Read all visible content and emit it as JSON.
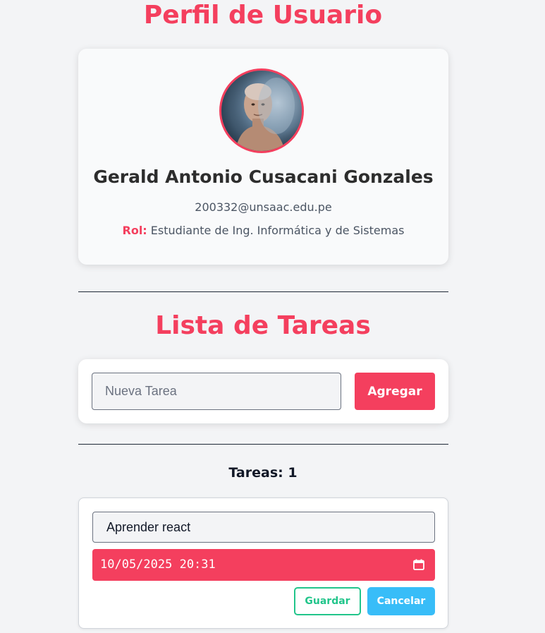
{
  "profile": {
    "title": "Perfil de Usuario",
    "name": "Gerald Antonio Cusacani Gonzales",
    "email": "200332@unsaac.edu.pe",
    "role_label": "Rol:",
    "role_value": "Estudiante de Ing. Informática y de Sistemas",
    "avatar_icon": "user-avatar-photo"
  },
  "tasks": {
    "title": "Lista de Tareas",
    "new_task_placeholder": "Nueva Tarea",
    "new_task_value": "",
    "add_label": "Agregar",
    "count_text": "Tareas: 1",
    "editing": {
      "text_value": "Aprender react",
      "date_value": "10/05/2025 20:31",
      "calendar_icon": "calendar-icon",
      "save_label": "Guardar",
      "cancel_label": "Cancelar"
    }
  },
  "colors": {
    "accent": "#f43f5e",
    "save": "#22c58b",
    "cancel": "#38bdf8",
    "background": "#f3f4f6"
  }
}
